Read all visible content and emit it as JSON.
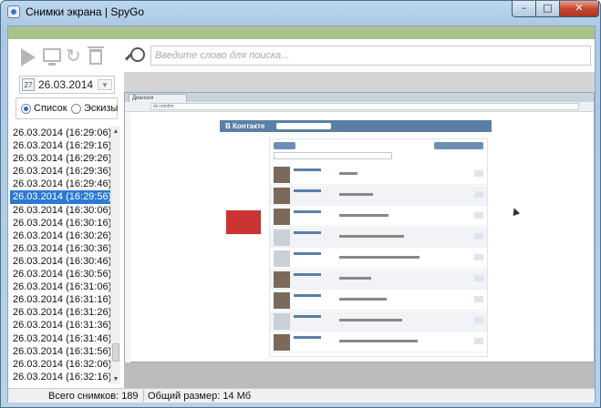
{
  "window": {
    "title": "Снимки экрана | SpyGo"
  },
  "search": {
    "placeholder": "Введите слово для поиска..."
  },
  "date_picker": {
    "value": "26.03.2014",
    "icon_text": "27"
  },
  "view_mode": {
    "list_label": "Список",
    "thumbs_label": "Эскизы",
    "selected": "list"
  },
  "snapshots": [
    "26.03.2014 (16:29:06)",
    "26.03.2014 (16:29:16)",
    "26.03.2014 (16:29:26)",
    "26.03.2014 (16:29:36)",
    "26.03.2014 (16:29:46)",
    "26.03.2014 (16:29:56)",
    "26.03.2014 (16:30:06)",
    "26.03.2014 (16:30:16)",
    "26.03.2014 (16:30:26)",
    "26.03.2014 (16:30:36)",
    "26.03.2014 (16:30:46)",
    "26.03.2014 (16:30:56)",
    "26.03.2014 (16:31:06)",
    "26.03.2014 (16:31:16)",
    "26.03.2014 (16:31:26)",
    "26.03.2014 (16:31:36)",
    "26.03.2014 (16:31:46)",
    "26.03.2014 (16:31:56)",
    "26.03.2014 (16:32:06)",
    "26.03.2014 (16:32:16)"
  ],
  "selected_snapshot": "26.03.2014 (16:29:56)",
  "preview": {
    "tab_label": "Диалоги",
    "address": "vk.com/im",
    "site_logo": "В Контакте"
  },
  "status": {
    "total": "Всего снимков: 189",
    "size": "Общий размер: 14 Мб"
  },
  "colors": {
    "accent_green": "#a8c28b",
    "selection": "#2a7ad4"
  }
}
